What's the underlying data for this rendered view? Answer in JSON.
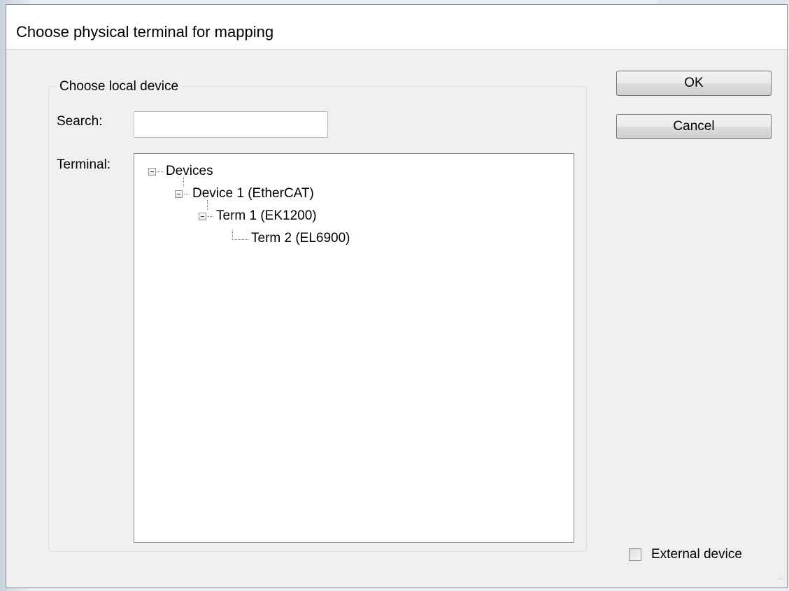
{
  "dialog": {
    "title": "Choose physical terminal for mapping"
  },
  "group": {
    "legend": "Choose local device",
    "search_label": "Search:",
    "search_value": "",
    "terminal_label": "Terminal:"
  },
  "tree": {
    "nodes": [
      {
        "label": "Devices",
        "level": 0,
        "expanded": true
      },
      {
        "label": "Device 1 (EtherCAT)",
        "level": 1,
        "expanded": true
      },
      {
        "label": "Term 1 (EK1200)",
        "level": 2,
        "expanded": true
      },
      {
        "label": "Term 2 (EL6900)",
        "level": 3,
        "expanded": false
      }
    ]
  },
  "buttons": {
    "ok": "OK",
    "cancel": "Cancel"
  },
  "external_device": {
    "label": "External device",
    "checked": false
  }
}
